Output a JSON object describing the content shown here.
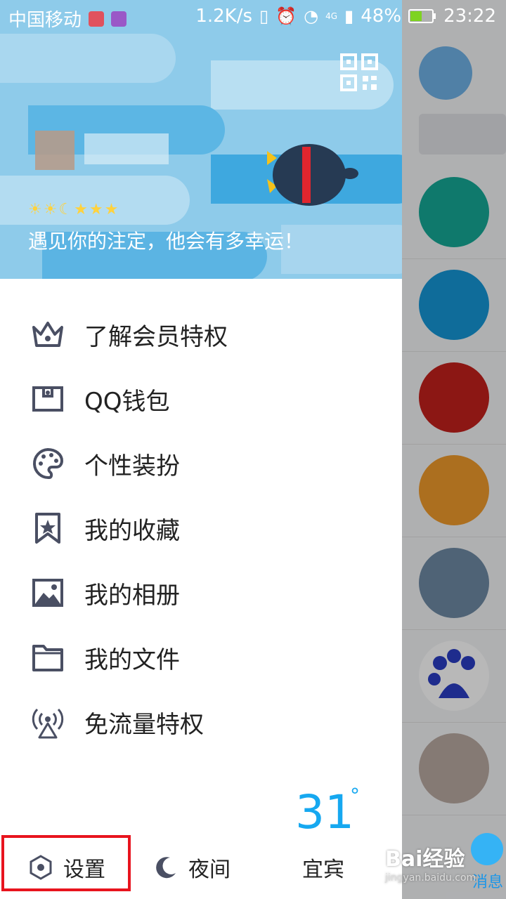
{
  "status_bar": {
    "carrier": "中国移动",
    "speed": "1.2K/s",
    "network": "4G",
    "battery": "48%",
    "time": "23:22"
  },
  "profile": {
    "signature": "遇见你的注定，他会有多幸运！",
    "level_icons": [
      "sun-icon",
      "sun-icon",
      "moon-icon",
      "star-icon",
      "star-icon",
      "star-icon"
    ]
  },
  "menu": {
    "items": [
      {
        "label": "了解会员特权",
        "icon": "crown-icon"
      },
      {
        "label": "QQ钱包",
        "icon": "wallet-icon"
      },
      {
        "label": "个性装扮",
        "icon": "palette-icon"
      },
      {
        "label": "我的收藏",
        "icon": "bookmark-star-icon"
      },
      {
        "label": "我的相册",
        "icon": "image-icon"
      },
      {
        "label": "我的文件",
        "icon": "folder-icon"
      },
      {
        "label": "免流量特权",
        "icon": "antenna-icon"
      }
    ]
  },
  "weather": {
    "temperature": "31",
    "degree_symbol": "°",
    "city": "宜宾"
  },
  "bottom_bar": {
    "settings": "设置",
    "night": "夜间"
  },
  "side_panel": {
    "message_label": "消息"
  },
  "watermark": {
    "brand": "Bai经验",
    "url": "jingyan.baidu.com"
  },
  "colors": {
    "accent": "#16a8f0",
    "highlight_border": "#e8141e",
    "icon_gray": "#4a4f63"
  }
}
